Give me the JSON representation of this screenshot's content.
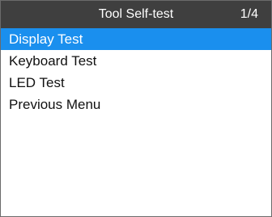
{
  "header": {
    "title": "Tool Self-test",
    "page_indicator": "1/4"
  },
  "menu": {
    "selected_index": 0,
    "items": [
      {
        "label": "Display Test"
      },
      {
        "label": "Keyboard Test"
      },
      {
        "label": "LED Test"
      },
      {
        "label": "Previous Menu"
      }
    ]
  },
  "colors": {
    "title_bar": "#3f3f3f",
    "selection": "#1a8fee"
  }
}
